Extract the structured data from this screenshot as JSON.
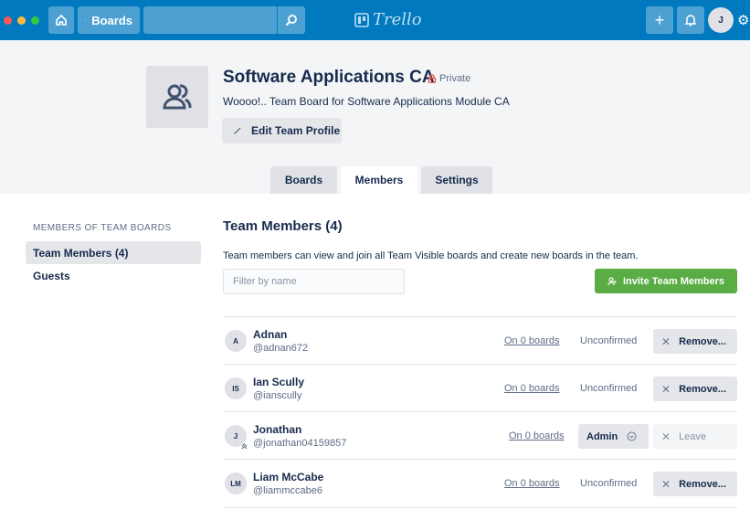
{
  "topbar": {
    "boards_label": "Boards",
    "logo_text": "Trello",
    "user_initial": "J",
    "traffic_colors": [
      "#fc5753",
      "#fdbc40",
      "#33c748"
    ],
    "icons": [
      "home-icon",
      "boards-icon",
      "search-icon",
      "plus-icon",
      "bell-icon",
      "gear-icon"
    ]
  },
  "team": {
    "name": "Software Applications CA",
    "visibility": "Private",
    "description": "Woooo!.. Team Board for Software Applications Module CA",
    "edit_label": "Edit Team Profile"
  },
  "tabs": [
    {
      "label": "Boards",
      "active": false
    },
    {
      "label": "Members",
      "active": true
    },
    {
      "label": "Settings",
      "active": false
    }
  ],
  "sidebar": {
    "heading": "MEMBERS OF TEAM BOARDS",
    "items": [
      {
        "label": "Team Members (4)",
        "active": true
      },
      {
        "label": "Guests",
        "active": false
      }
    ]
  },
  "main": {
    "title": "Team Members (4)",
    "description": "Team members can view and join all Team Visible boards and create new boards in the team.",
    "filter_placeholder": "Filter by name",
    "invite_label": "Invite Team Members",
    "members": [
      {
        "initials": "A",
        "name": "Adnan",
        "username": "@adnan672",
        "boards": "On 0 boards",
        "status": "Unconfirmed",
        "action": "Remove..."
      },
      {
        "initials": "IS",
        "name": "Ian Scully",
        "username": "@ianscully",
        "boards": "On 0 boards",
        "status": "Unconfirmed",
        "action": "Remove..."
      },
      {
        "initials": "J",
        "name": "Jonathan",
        "username": "@jonathan04159857",
        "boards": "On 0 boards",
        "role": "Admin",
        "action": "Leave"
      },
      {
        "initials": "LM",
        "name": "Liam McCabe",
        "username": "@liammccabe6",
        "boards": "On 0 boards",
        "status": "Unconfirmed",
        "action": "Remove..."
      }
    ]
  },
  "colors": {
    "topbar": "#0079bf",
    "invite_green": "#5aac44",
    "private_red": "#eb5a46"
  }
}
